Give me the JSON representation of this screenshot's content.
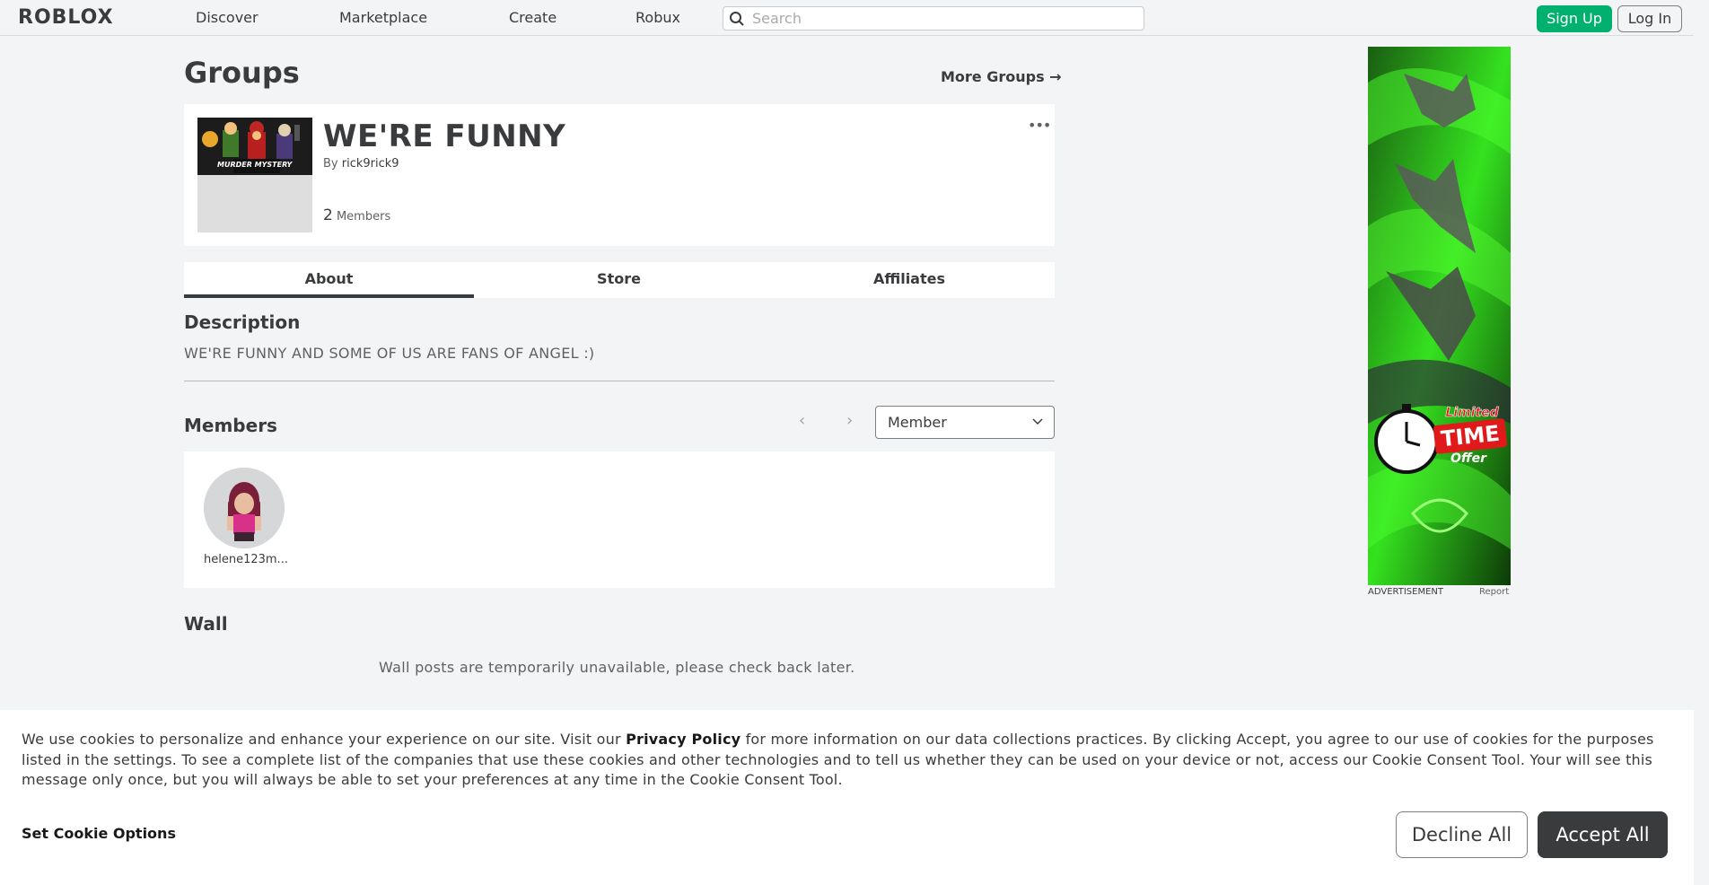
{
  "nav": {
    "logo": "ROBLOX",
    "links": [
      "Discover",
      "Marketplace",
      "Create",
      "Robux"
    ],
    "search_placeholder": "Search",
    "signup": "Sign Up",
    "login": "Log In"
  },
  "page": {
    "title": "Groups",
    "more_groups": "More Groups →"
  },
  "group": {
    "emblem_text": "MURDER MYSTERY",
    "name": "WE'RE FUNNY",
    "by_label": "By",
    "owner": "rick9rick9",
    "member_count": "2",
    "members_label": "Members",
    "more_menu": "•••"
  },
  "tabs": [
    "About",
    "Store",
    "Affiliates"
  ],
  "description": {
    "heading": "Description",
    "text": "WE'RE FUNNY AND SOME OF US ARE FANS OF ANGEL :)"
  },
  "members": {
    "heading": "Members",
    "prev": "‹",
    "next": "›",
    "role": "Member",
    "list": [
      {
        "name": "helene123m..."
      }
    ]
  },
  "wall": {
    "heading": "Wall",
    "message": "Wall posts are temporarily unavailable, please check back later."
  },
  "ad": {
    "label": "ADVERTISEMENT",
    "report": "Report",
    "limited": "Limited",
    "time": "TIME",
    "offer": "Offer"
  },
  "cookie": {
    "text_before": "We use cookies to personalize and enhance your experience on our site. Visit our ",
    "privacy_link": "Privacy Policy",
    "text_after": " for more information on our data collections practices. By clicking Accept, you agree to our use of cookies for the purposes listed in the settings. To see a complete list of the companies that use these cookies and other technologies and to tell us whether they can be used on your device or not, access our Cookie Consent Tool. Your will see this message only once, but you will always be able to set your preferences at any time in the Cookie Consent Tool.",
    "options": "Set Cookie Options",
    "decline": "Decline All",
    "accept": "Accept All"
  }
}
